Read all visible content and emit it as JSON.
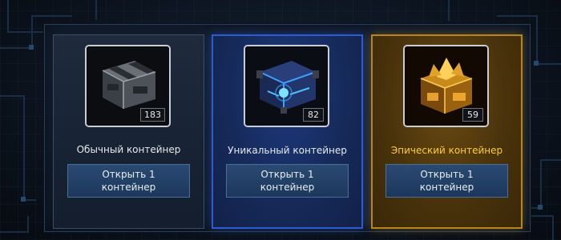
{
  "containers": [
    {
      "name": "Обычный контейнер",
      "count": "183",
      "button_line1": "Открыть 1",
      "button_line2": "контейнер",
      "icon": "common-crate-icon"
    },
    {
      "name": "Уникальный контейнер",
      "count": "82",
      "button_line1": "Открыть 1",
      "button_line2": "контейнер",
      "icon": "unique-crate-icon"
    },
    {
      "name": "Эпический контейнер",
      "count": "59",
      "button_line1": "Открыть 1",
      "button_line2": "контейнер",
      "icon": "epic-crate-icon"
    }
  ],
  "colors": {
    "common_border": "#3a4e68",
    "unique_accent": "#2e5bd0",
    "epic_accent": "#b7861a",
    "epic_text": "#ffcf2e",
    "button_bg": "#24426a"
  }
}
